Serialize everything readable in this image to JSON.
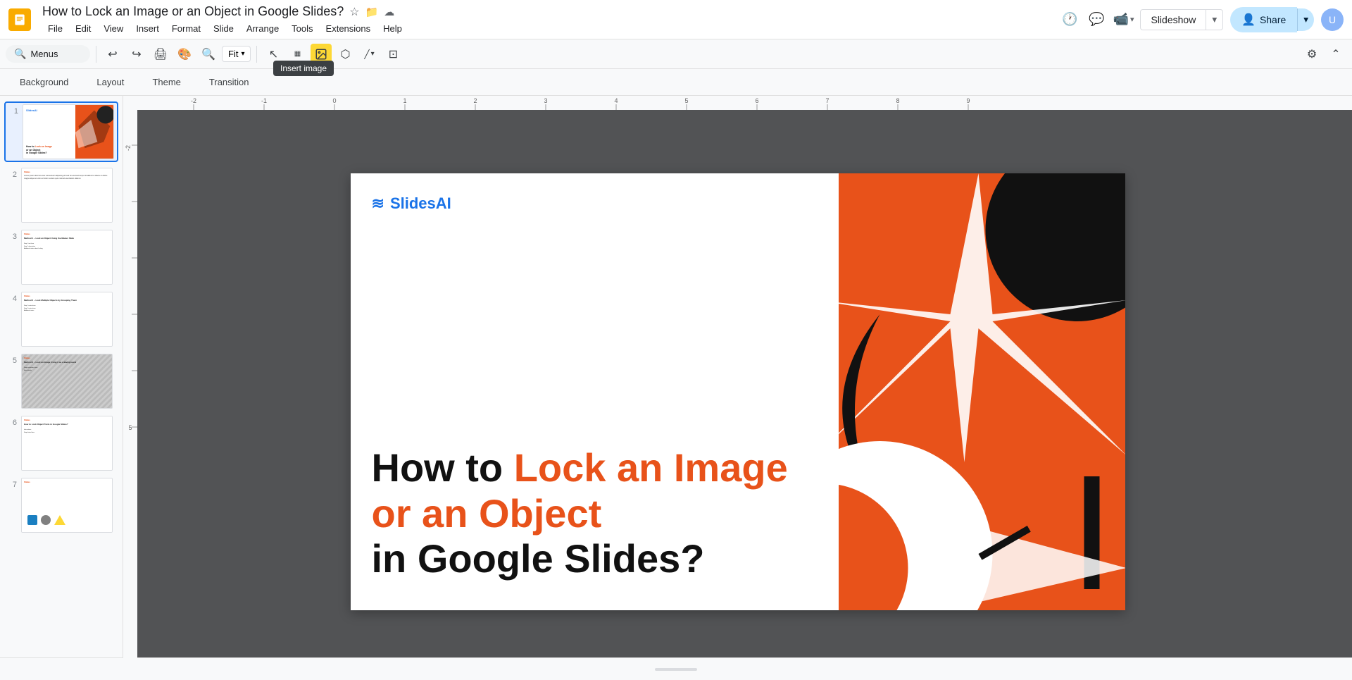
{
  "app": {
    "logo_color": "#f9ab00",
    "title": "How to Lock an Image or an Object in Google Slides?",
    "doc_actions": {
      "star": "⭐",
      "folder": "📁",
      "cloud": "☁"
    }
  },
  "menu": {
    "items": [
      "File",
      "Edit",
      "View",
      "Insert",
      "Format",
      "Slide",
      "Arrange",
      "Tools",
      "Extensions",
      "Help"
    ]
  },
  "toolbar": {
    "search_placeholder": "Menus",
    "fit_label": "Fit",
    "zoom_icon": "🔍"
  },
  "format_toolbar": {
    "background": "Background",
    "layout": "Layout",
    "theme": "Theme",
    "transition": "Transition"
  },
  "slideshow_btn": "Slideshow",
  "share_btn": "Share",
  "tooltip": "Insert image",
  "slide": {
    "logo_text": "SlidesAI",
    "title_part1": "How to ",
    "title_part2": "Lock an Image",
    "title_part3": " or an Object",
    "title_part4": "or an Object",
    "title_part5": "\nin Google Slides?"
  },
  "slides_panel": {
    "items": [
      {
        "num": "1",
        "active": true
      },
      {
        "num": "2",
        "active": false
      },
      {
        "num": "3",
        "active": false
      },
      {
        "num": "4",
        "active": false
      },
      {
        "num": "5",
        "active": false
      },
      {
        "num": "6",
        "active": false
      },
      {
        "num": "7",
        "active": false
      }
    ]
  }
}
